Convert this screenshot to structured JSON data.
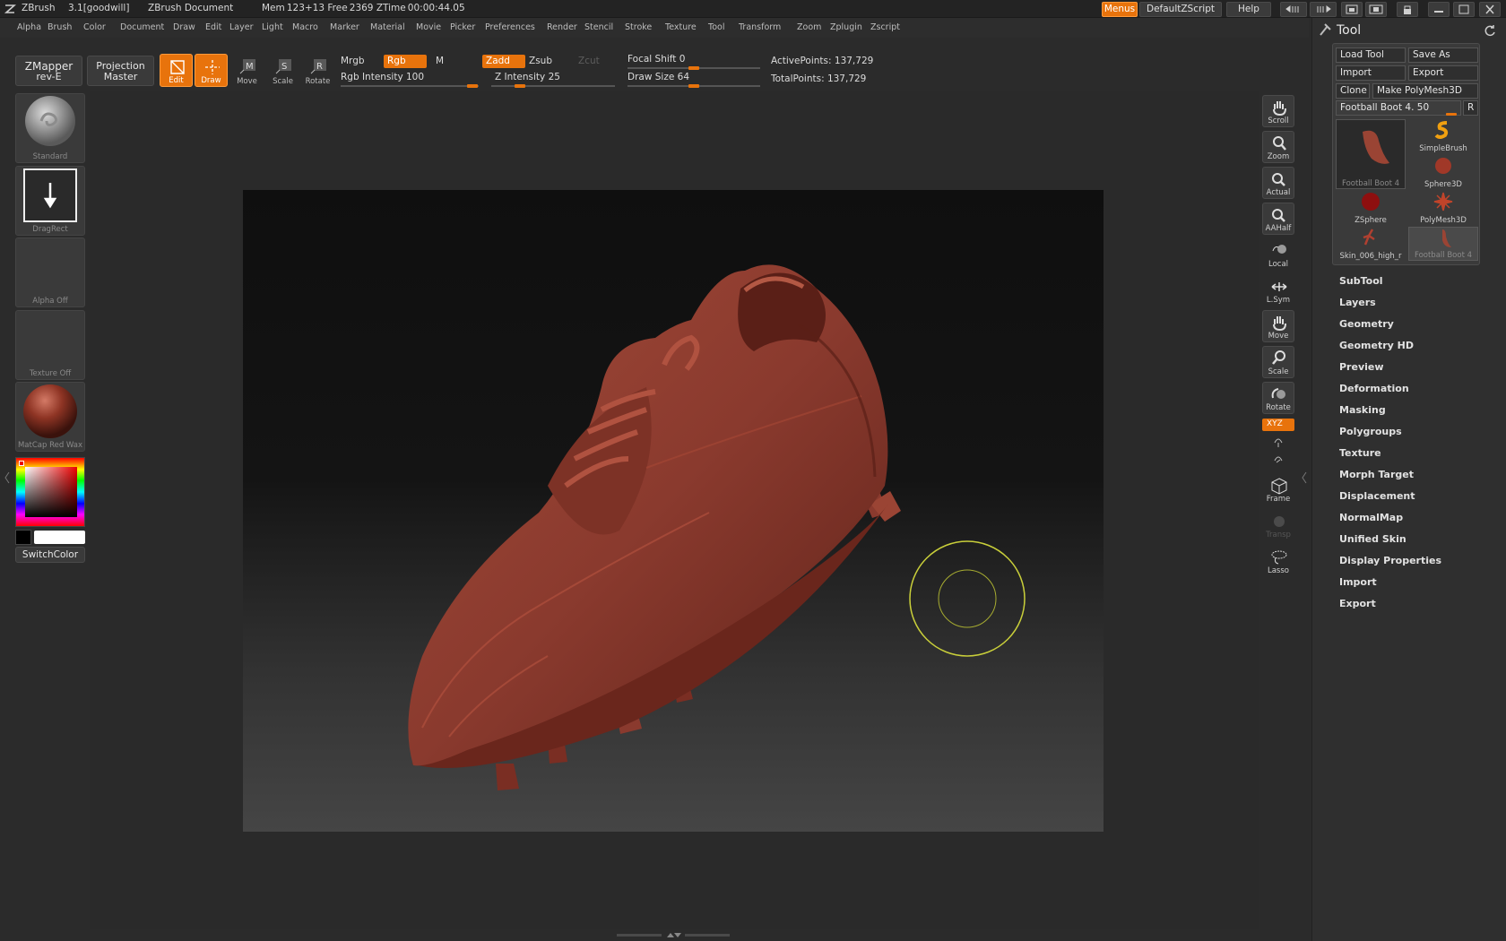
{
  "titlebar": {
    "app": "ZBrush",
    "version": "3.1[goodwill]",
    "document": "ZBrush Document",
    "stats": "Mem 123+13  Free 2369  ZTime 00:00:44.05",
    "menus_button": "Menus",
    "script_button": "DefaultZScript",
    "help_button": "Help"
  },
  "menubar": {
    "items": [
      "Alpha",
      "Brush",
      "Color",
      "Document",
      "Draw",
      "Edit",
      "Layer",
      "Light",
      "Macro",
      "Marker",
      "Material",
      "Movie",
      "Picker",
      "Preferences",
      "Render",
      "Stencil",
      "Stroke",
      "Texture",
      "Tool",
      "Transform",
      "Zoom",
      "Zplugin",
      "Zscript"
    ]
  },
  "toolbar": {
    "zmapper": [
      "ZMapper",
      "rev-E"
    ],
    "projection": [
      "Projection",
      "Master"
    ],
    "modes": [
      "Edit",
      "Draw",
      "Move",
      "Scale",
      "Rotate"
    ],
    "mrgb": "Mrgb",
    "rgb": "Rgb",
    "m": "M",
    "rgb_intensity": "Rgb Intensity 100",
    "rgb_intensity_value": 100,
    "zadd": "Zadd",
    "zsub": "Zsub",
    "zcut": "Zcut",
    "z_intensity": "Z Intensity 25",
    "z_intensity_value": 25,
    "focal_shift": "Focal Shift 0",
    "focal_shift_value": 0,
    "draw_size": "Draw Size 64",
    "draw_size_value": 64,
    "active_points": "ActivePoints: 137,729",
    "total_points": "TotalPoints: 137,729"
  },
  "shelf": {
    "brush": "Standard",
    "stroke": "DragRect",
    "alpha": "Alpha Off",
    "texture": "Texture Off",
    "material": "MatCap Red Wax",
    "switch_color": "SwitchColor"
  },
  "viewbar": {
    "buttons": [
      "Scroll",
      "Zoom",
      "Actual",
      "AAHalf",
      "Local",
      "L.Sym",
      "Move",
      "Scale",
      "Rotate",
      "Frame",
      "Transp",
      "Lasso"
    ],
    "xyz": "XYZ"
  },
  "palette": {
    "title": "Tool",
    "load_tool": "Load Tool",
    "save_as": "Save As",
    "import": "Import",
    "export": "Export",
    "clone": "Clone",
    "make_polymesh": "Make PolyMesh3D",
    "current_tool": "Football Boot 4. 50",
    "r_button": "R",
    "tools": [
      "Football Boot 4",
      "SimpleBrush",
      "Sphere3D",
      "ZSphere",
      "PolyMesh3D",
      "Skin_006_high_r",
      "Football Boot 4"
    ],
    "sections": [
      "SubTool",
      "Layers",
      "Geometry",
      "Geometry HD",
      "Preview",
      "Deformation",
      "Masking",
      "Polygroups",
      "Texture",
      "Morph Target",
      "Displacement",
      "NormalMap",
      "Unified Skin",
      "Display Properties",
      "Import",
      "Export"
    ]
  },
  "colors": {
    "accent": "#e8730c",
    "model": "#8a3a2e",
    "brush_cursor": "#c9cf3a"
  }
}
